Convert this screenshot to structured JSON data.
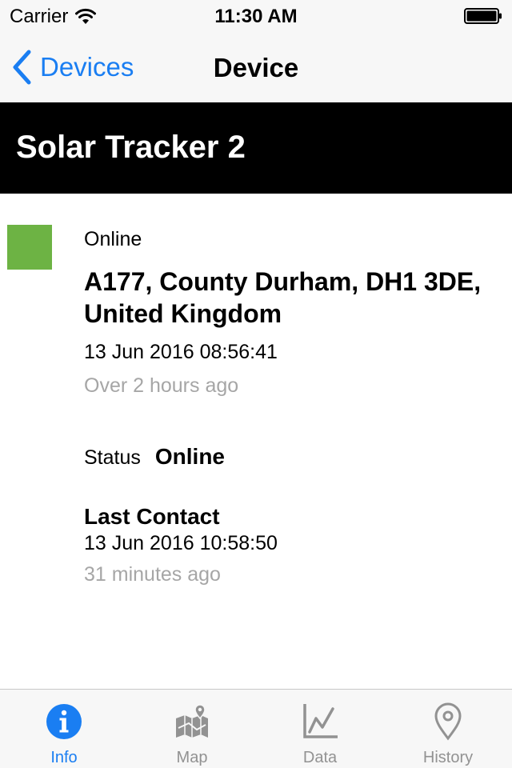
{
  "status_bar": {
    "carrier": "Carrier",
    "time": "11:30 AM",
    "icons": [
      "wifi-icon",
      "battery-icon"
    ]
  },
  "nav": {
    "back_label": "Devices",
    "title": "Device",
    "back_icon": "chevron-left-icon"
  },
  "device": {
    "name": "Solar Tracker 2",
    "indicator_color": "#6db344",
    "online_label": "Online",
    "address": "A177, County Durham, DH1 3DE, United Kingdom",
    "location_time": "13 Jun 2016 08:56:41",
    "location_ago": "Over 2 hours ago",
    "status_label": "Status",
    "status_value": "Online",
    "last_contact_label": "Last Contact",
    "last_contact_time": "13 Jun 2016 10:58:50",
    "last_contact_ago": "31 minutes ago"
  },
  "tabs": [
    {
      "label": "Info",
      "icon": "info-icon",
      "active": true
    },
    {
      "label": "Map",
      "icon": "map-icon",
      "active": false
    },
    {
      "label": "Data",
      "icon": "chart-icon",
      "active": false
    },
    {
      "label": "History",
      "icon": "location-pin-icon",
      "active": false
    }
  ],
  "colors": {
    "accent": "#1a7ef2",
    "inactive": "#929292",
    "banner": "#000000",
    "secondary_text": "#a6a6a6"
  }
}
